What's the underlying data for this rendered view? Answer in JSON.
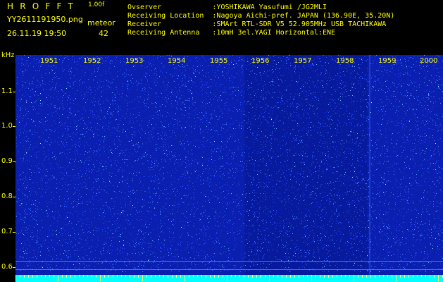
{
  "header": {
    "app_title": "HROFFT",
    "version": "1.00f",
    "filename": "YY2611191950.png",
    "meteor_label": "meteor",
    "timestamp": "26.11.19 19:50",
    "meteor_count": "42"
  },
  "station": {
    "observer": "Ovserver            :YOSHIKAWA Yasufumi /JG2MLI",
    "location": "Receiving Location  :Nagoya Aichi-pref. JAPAN (136.90E, 35.20N)",
    "receiver": "Receiver            :SMArt RTL-SDR V5 52.905MHz USB TACHIKAWA",
    "antenna": "Receiving Antenna   :10mH 3el.YAGI Horizontal:ENE"
  },
  "spectrogram": {
    "y_unit": "kHz",
    "y_labels": [
      "1.1",
      "1.0",
      "0.9",
      "0.8",
      "0.7",
      "0.6"
    ],
    "minute_labels": [
      "1951",
      "1952",
      "1953",
      "1954",
      "1955",
      "1956",
      "1957",
      "1958",
      "1959",
      "2000"
    ],
    "colors": {
      "background": "#0a1fb0",
      "text": "#ffff00",
      "baseline": "#00ffff"
    }
  }
}
